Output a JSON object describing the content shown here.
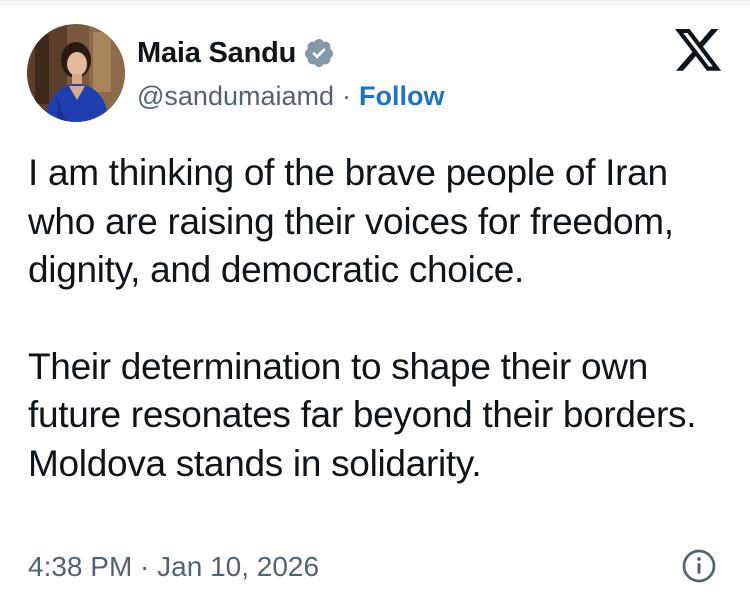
{
  "author": {
    "display_name": "Maia Sandu",
    "handle": "@sandumaiamd",
    "separator": "·",
    "follow_label": "Follow",
    "verified_icon": "verified-badge-icon"
  },
  "platform": {
    "logo_icon": "x-logo-icon"
  },
  "tweet": {
    "paragraphs": [
      "I am thinking of the brave people of Iran who are raising their voices for freedom, dignity, and democratic choice.",
      "Their determination to shape their own future resonates far beyond their borders. Moldova stands in solidarity."
    ],
    "timestamp": "4:38 PM · Jan 10, 2026",
    "info_icon": "info-icon"
  },
  "colors": {
    "text": "#0f1419",
    "secondary": "#536471",
    "follow": "#1d72c9",
    "verified": "#829aab"
  }
}
